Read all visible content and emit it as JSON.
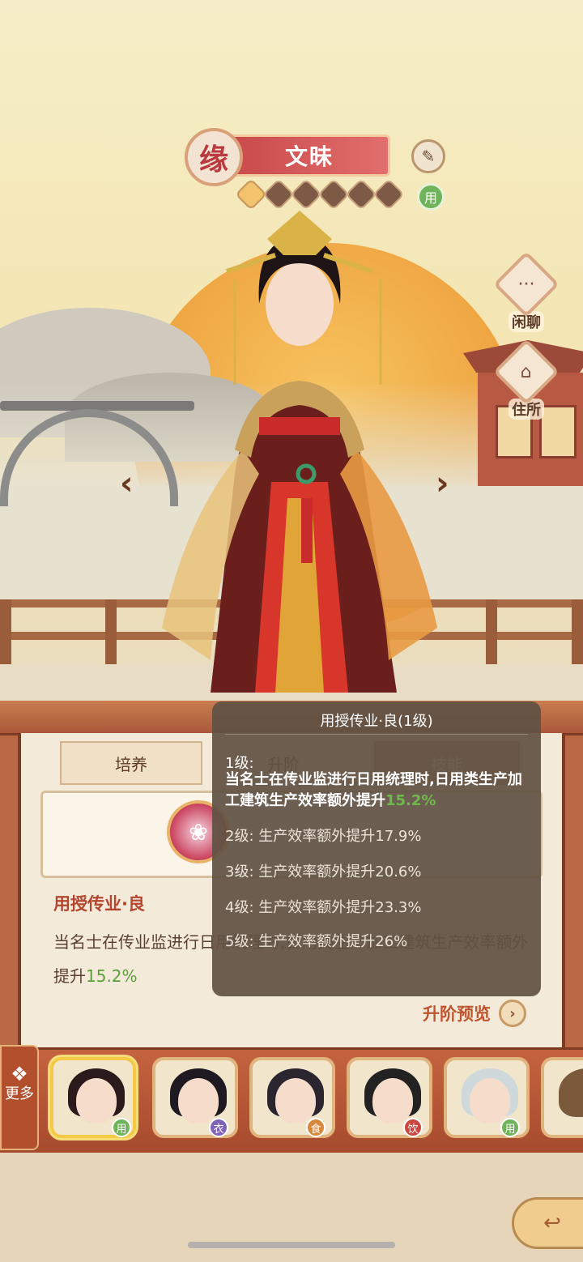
{
  "character": {
    "name": "文昧",
    "badge": "缘",
    "usage_tag": "用",
    "stars_filled": 1,
    "stars_total": 6
  },
  "side_buttons": [
    {
      "label": "闲聊",
      "icon": "chat-icon"
    },
    {
      "label": "住所",
      "icon": "house-icon"
    }
  ],
  "tabs": [
    {
      "label": "培养"
    },
    {
      "label": "升阶"
    },
    {
      "label": "技能"
    }
  ],
  "skill": {
    "title": "用授传业·良",
    "desc_prefix": "当名士在传业监进行日用统理时,日用类生产加工建筑生产效率额外提升",
    "desc_value": "15.2%",
    "upgrade_preview": "升阶预览"
  },
  "tooltip": {
    "title": "用授传业·良(1级)",
    "level1_head": "1级:",
    "level1_body": "当名士在传业监进行日用统理时,日用类生产加工建筑生产效率额外提升",
    "level1_value": "15.2%",
    "levels": [
      "2级: 生产效率额外提升17.9%",
      "3级: 生产效率额外提升20.6%",
      "4级: 生产效率额外提升23.3%",
      "5级: 生产效率额外提升26%"
    ]
  },
  "roster": {
    "more_label": "更多",
    "items": [
      {
        "badge": "用",
        "badge_color": "#6fb35a",
        "selected": true
      },
      {
        "badge": "衣",
        "badge_color": "#7f63b8",
        "selected": false
      },
      {
        "badge": "食",
        "badge_color": "#d8883a",
        "selected": false
      },
      {
        "badge": "饮",
        "badge_color": "#c9473e",
        "selected": false
      },
      {
        "badge": "用",
        "badge_color": "#6fb35a",
        "selected": false
      }
    ]
  },
  "colors": {
    "accent_red": "#c94a4a",
    "highlight_green": "#5b9e3b",
    "panel_brown": "#b96a44"
  }
}
